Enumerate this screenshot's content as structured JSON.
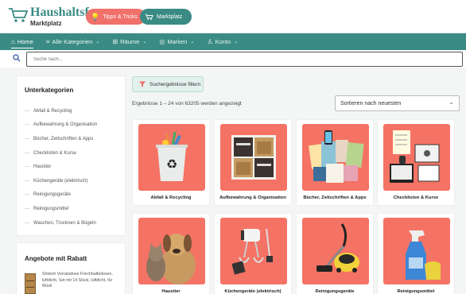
{
  "brand": {
    "name": "Haushaltsfee",
    "sub": "Marktplatz"
  },
  "pills": {
    "tips": "Tipps & Tricks",
    "market": "Marktplatz"
  },
  "nav": {
    "home": "Home",
    "categories": "Alle Kategorien",
    "rooms": "Räume",
    "brands": "Marken",
    "account": "Konto"
  },
  "search": {
    "placeholder": "Suche nach..."
  },
  "sidebar": {
    "title": "Unterkategorien",
    "items": [
      "Abfall & Recycling",
      "Aufbewahrung & Organisation",
      "Bücher, Zeitschriften & Apps",
      "Checklisten & Kurse",
      "Haustier",
      "Küchengeräte (elektrisch)",
      "Reinigungsgeräte",
      "Reinigungsmittel",
      "Waschen, Trocknen & Bügeln"
    ]
  },
  "offers": {
    "title": "Angebote mit Rabatt",
    "item_text": "Sintech Vorratsdose Frischhaltedosen, luftdicht, Set mit 14 Stück, luftdicht, für Müsli"
  },
  "filter_button": "Suchergebnisse filtern",
  "results_text": "Ergebnisse 1 – 24 von 63205 werden angezeigt",
  "sort": {
    "selected": "Sortieren nach neuesten"
  },
  "cards": [
    {
      "label": "Abfall & Recycling"
    },
    {
      "label": "Aufbewahrung & Organisation"
    },
    {
      "label": "Bücher, Zeitschriften & Apps"
    },
    {
      "label": "Checklisten & Kurse"
    },
    {
      "label": "Haustier"
    },
    {
      "label": "Küchengeräte (elektrisch)"
    },
    {
      "label": "Reinigungsgeräte"
    },
    {
      "label": "Reinigungsmittel"
    }
  ],
  "colors": {
    "accent": "#3a8b84",
    "coral": "#f47365",
    "pill_red": "#f0706a"
  }
}
